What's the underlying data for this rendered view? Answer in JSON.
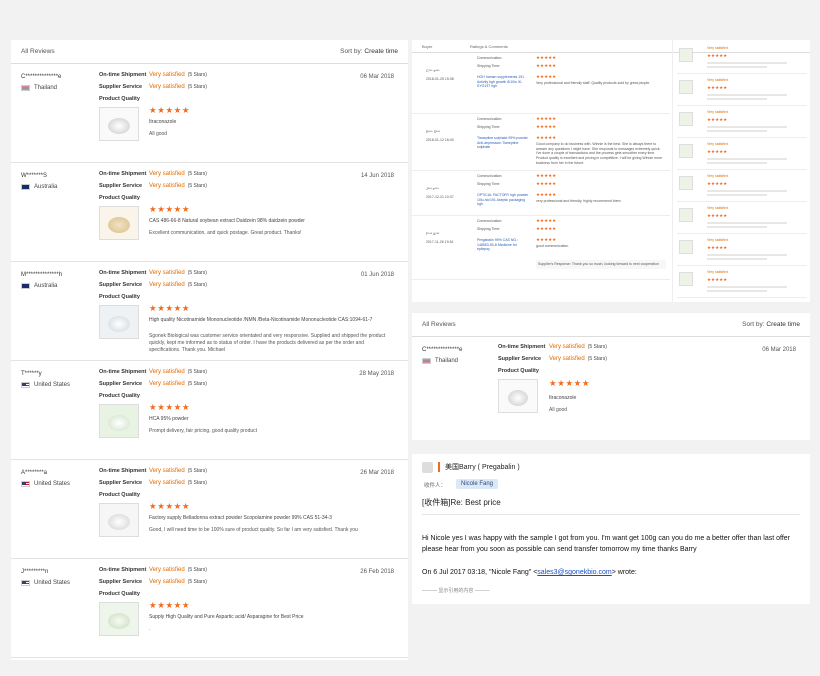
{
  "left": {
    "title": "All Reviews",
    "sort_prefix": "Sort by:",
    "sort_value": "Create time",
    "labels": {
      "ontime": "On-time Shipment",
      "supplier": "Supplier Service",
      "quality": "Product Quality"
    },
    "reviews": [
      {
        "name": "C**************e",
        "country": "Thailand",
        "flag": "th",
        "date": "06 Mar 2018",
        "sat1": "Very satisfied",
        "sat2": "Very satisfied",
        "five": "(5 Stars)",
        "stars": "★★★★★",
        "product": "Itraconazole",
        "comment": "All good"
      },
      {
        "name": "W*******S",
        "country": "Australia",
        "flag": "au",
        "date": "14 Jun 2018",
        "sat1": "Very satisfied",
        "sat2": "Very satisfied",
        "five": "(5 Stars)",
        "stars": "★★★★★",
        "product": "CAS 486-66-8 Natural soybean extract Daidzein 98% daidzein powder",
        "comment": "Excellent communication, and quick postage. Great product. Thanks!"
      },
      {
        "name": "M**************h",
        "country": "Australia",
        "flag": "au",
        "date": "01 Jun 2018",
        "sat1": "Very satisfied",
        "sat2": "Very satisfied",
        "five": "(5 Stars)",
        "stars": "★★★★★",
        "product": "High quality Nicotinamide Mononucleotide /NMN /Beta-Nicotinamide Mononucleotide CAS:1094-61-7",
        "comment": "Sgonek Biological was customer service orientated and very responsive. Supplied and shipped the product quickly, kept me informed as to status of order. I have the products delivered as per the order and specifications. Thank you. Michael"
      },
      {
        "name": "T******y",
        "country": "United States",
        "flag": "us",
        "date": "28 May 2018",
        "sat1": "Very satisfied",
        "sat2": "Very satisfied",
        "five": "(5 Stars)",
        "stars": "★★★★★",
        "product": "HCA 95% powder",
        "comment": "Prompt delivery, fair pricing, good quality product"
      },
      {
        "name": "A********a",
        "country": "United States",
        "flag": "us",
        "date": "26 Mar 2018",
        "sat1": "Very satisfied",
        "sat2": "Very satisfied",
        "five": "(5 Stars)",
        "stars": "★★★★★",
        "product": "Factory supply Belladonna extract powder Scopolamine powder 99% CAS 51-34-3",
        "comment": "Good, I will need time to be 100% sure of product quality. So far I am very satisfied. Thank you"
      },
      {
        "name": "J*********n",
        "country": "United States",
        "flag": "us",
        "date": "26 Feb 2018",
        "sat1": "Very satisfied",
        "sat2": "Very satisfied",
        "five": "(5 Stars)",
        "stars": "★★★★★",
        "product": "Supply High Quality and Pure Aspartic acid/ Asparagine for Best Price",
        "comment": "."
      }
    ]
  },
  "table": {
    "headers": [
      "Buyer",
      "Ratings & Comments"
    ],
    "rows": [
      {
        "buyer": "C*** e***",
        "date": "2018-01-25 15:38",
        "l1": "Communication:",
        "l2": "Shipping Time:",
        "product": "HGH human supplements 191 Activity hgh growth 8/10iu /K-SYG197 hgh",
        "comment": "Very professional and friendly staff. Quality products sold by great people."
      },
      {
        "buyer": "R*** S***",
        "date": "2018-01-12 16:40",
        "l1": "Communication:",
        "l2": "Shipping Time:",
        "product": "Tianeptine sulphate 99% powder Anti-depression Tianeptine sulphate",
        "comment": "Good company to do business with. Winnie is the best. She is always there to answer any questions I might have. She responds to messages extremely quick. I've done a couple of transactions and the process gets smoother every time. Product quality is excellent and pricing is competitive. I will be giving Winnie more business from her in the future."
      },
      {
        "buyer": "J*** e***",
        "date": "2017-12-21 10:37",
        "l1": "Communication:",
        "l2": "Shipping Time:",
        "product": "OPTICAL FACTORY hgh powder 10iu /sk/191 Aseptic packaging hgh",
        "comment": "very professional and friendly, highly recommend them"
      },
      {
        "buyer": "F*** A***",
        "date": "2017-11-26 19:16",
        "l1": "Communication:",
        "l2": "Shipping Time:",
        "product": "Pregabalin 99% CAS NO.: 148553-50-8 Medicine for epilepsy",
        "comment": "good communication",
        "reply_label": "Supplier's Response:",
        "reply": "Thank you so much, looking forward to next cooperation"
      }
    ],
    "mini_stars": "★★★★★",
    "side_header": "Very satisfied"
  },
  "middle": {
    "title": "All Reviews",
    "sort_prefix": "Sort by:",
    "sort_value": "Create time",
    "review": {
      "name": "C**************e",
      "country": "Thailand",
      "date": "06 Mar 2018",
      "sat1": "Very satisfied",
      "sat2": "Very satisfied",
      "five": "(5 Stars)",
      "stars": "★★★★★",
      "product": "Itraconazole",
      "comment": "All good"
    }
  },
  "email": {
    "sender": "美国Barry ( Pregabalin )",
    "recipient_label": "收件人：",
    "recipient": "Nicole Fang",
    "subject": "[收件箱]Re: Best price",
    "body": "Hi Nicole yes I was happy with the sample I got from you. I'm want get 100g can you do me a better offer than last offer please hear from you soon as possible can send transfer tomorrow my time thanks Barry",
    "on_prefix": "On 6 Jul 2017 03:18, \"Nicole Fang\" <",
    "email_link": "sales3@sgonekbio.com",
    "on_suffix": "> wrote:",
    "quote_toggle": "——— 显示引用的内容 ———"
  },
  "colors": {
    "accent": "#f26b1d",
    "satisfied": "#e46b00",
    "link": "#1a4fc4"
  }
}
